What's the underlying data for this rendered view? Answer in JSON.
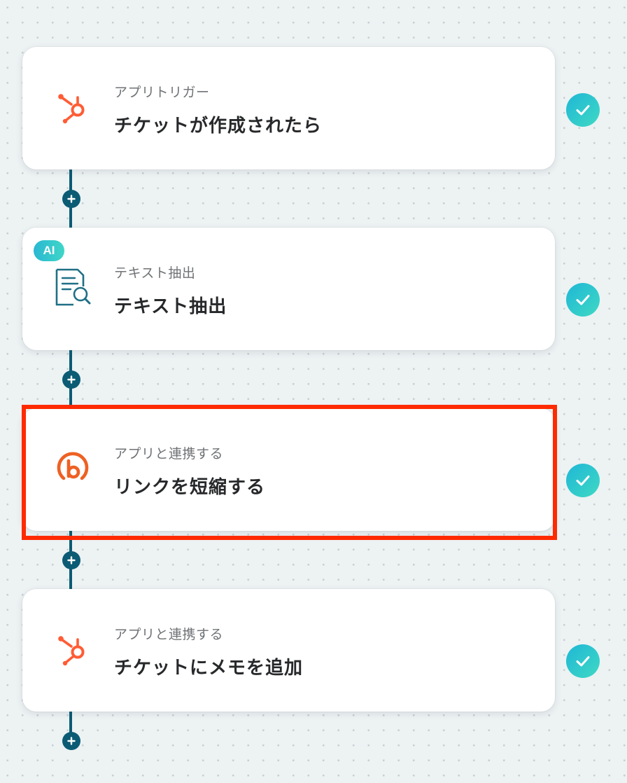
{
  "steps": [
    {
      "subtitle": "アプリトリガー",
      "title": "チケットが作成されたら",
      "icon": "hubspot-icon",
      "status": "completed"
    },
    {
      "badge": "AI",
      "subtitle": "テキスト抽出",
      "title": "テキスト抽出",
      "icon": "text-extract-document-icon",
      "status": "completed"
    },
    {
      "subtitle": "アプリと連携する",
      "title": "リンクを短縮する",
      "icon": "bitly-icon",
      "status": "completed",
      "highlighted": true
    },
    {
      "subtitle": "アプリと連携する",
      "title": "チケットにメモを追加",
      "icon": "hubspot-icon",
      "status": "completed"
    }
  ],
  "colors": {
    "connector": "#0b5b74",
    "hubspot": "#ff5c35",
    "bitly": "#ee6123",
    "check_gradient_start": "#1fb7d6",
    "check_gradient_end": "#3fd9c4",
    "highlight": "#ff2a00",
    "doc_icon": "#1f6f86"
  }
}
